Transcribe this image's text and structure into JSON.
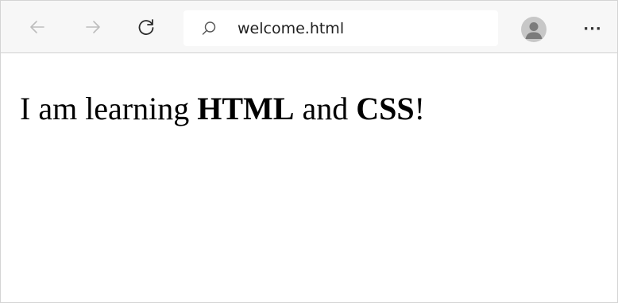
{
  "browser": {
    "address_bar": {
      "url_text": "welcome.html"
    },
    "more_label": "···",
    "icons": {
      "back": "arrow-left-icon",
      "forward": "arrow-right-icon",
      "reload": "refresh-icon",
      "search": "search-icon",
      "profile": "user-avatar-icon"
    }
  },
  "page": {
    "text_part1": "I am learning ",
    "bold_1": "HTML",
    "text_part2": " and ",
    "bold_2": "CSS",
    "text_part3": "!"
  }
}
